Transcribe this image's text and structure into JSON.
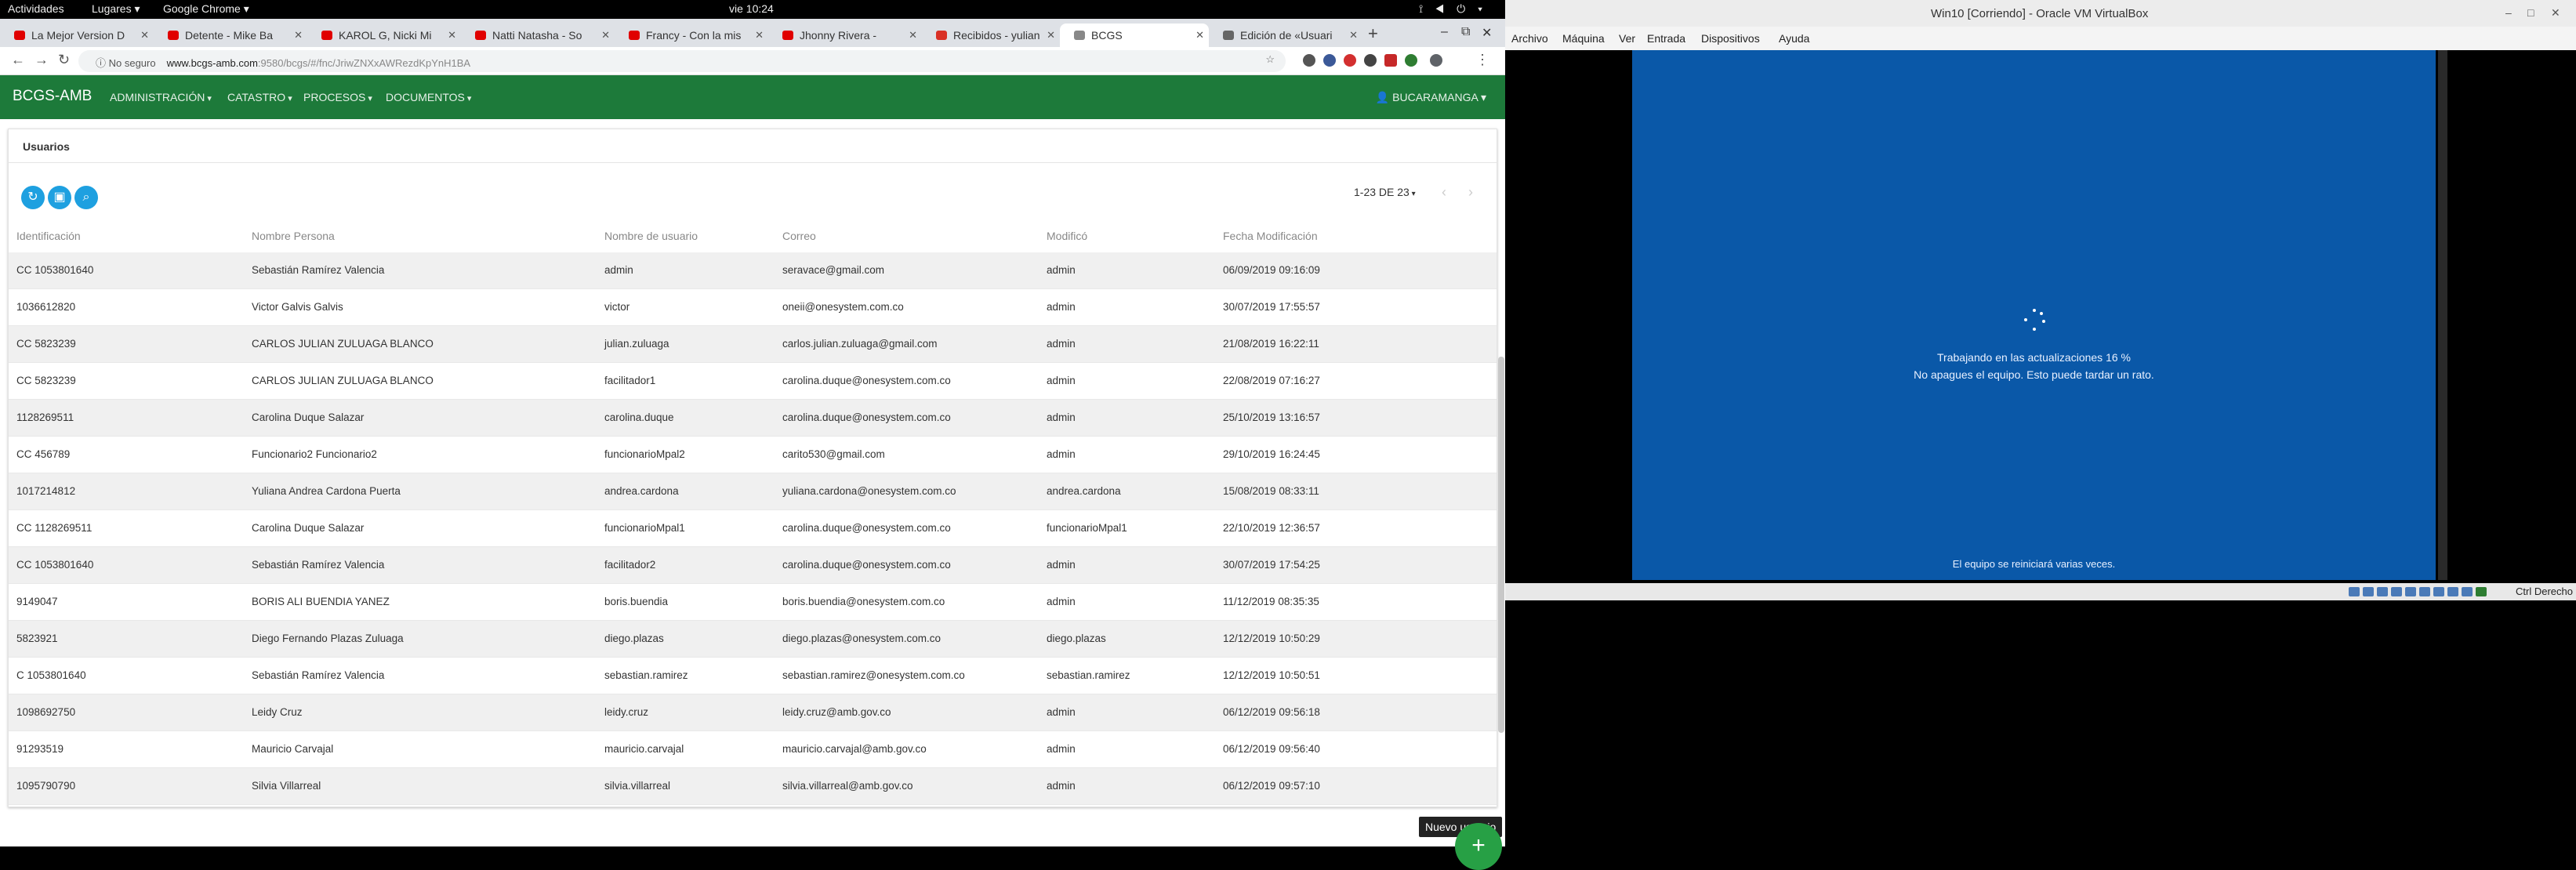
{
  "topbar": {
    "activities": "Actividades",
    "places": "Lugares ▾",
    "app": "Google Chrome ▾",
    "clock": "vie 10:24"
  },
  "chrome": {
    "tabs": [
      {
        "label": "La Mejor Version D",
        "color": "#e00000"
      },
      {
        "label": "Detente - Mike Ba",
        "color": "#e00000"
      },
      {
        "label": "KAROL G, Nicki Mi",
        "color": "#e00000"
      },
      {
        "label": "Natti Natasha - So",
        "color": "#e00000"
      },
      {
        "label": "Francy - Con la mis",
        "color": "#e00000"
      },
      {
        "label": "Jhonny Rivera - ",
        "color": "#e00000"
      },
      {
        "label": "Recibidos - yulian",
        "color": "#d93025"
      },
      {
        "label": "BCGS",
        "color": "#888888"
      },
      {
        "label": "Edición de «Usuari",
        "color": "#666666"
      }
    ],
    "omnibox": {
      "secure_label": "ⓘ No seguro",
      "url_host": "www.bcgs-amb.com",
      "url_path": ":9580/bcgs/#/fnc/JriwZNXxAWRezdKpYnH1BA"
    }
  },
  "app": {
    "brand": "BCGS-AMB",
    "menus": [
      "ADMINISTRACIÓN",
      "CATASTRO",
      "PROCESOS",
      "DOCUMENTOS"
    ],
    "user": "BUCARAMANGA",
    "panel_title": "Usuarios",
    "pager": "1-23 DE 23",
    "columns": [
      "Identificación",
      "Nombre Persona",
      "Nombre de usuario",
      "Correo",
      "Modificó",
      "Fecha Modificación"
    ],
    "rows": [
      [
        "CC 1053801640",
        "Sebastián Ramírez Valencia",
        "admin",
        "seravace@gmail.com",
        "admin",
        "06/09/2019 09:16:09"
      ],
      [
        "1036612820",
        "Victor Galvis Galvis",
        "victor",
        "oneii@onesystem.com.co",
        "admin",
        "30/07/2019 17:55:57"
      ],
      [
        "CC 5823239",
        "CARLOS JULIAN ZULUAGA BLANCO",
        "julian.zuluaga",
        "carlos.julian.zuluaga@gmail.com",
        "admin",
        "21/08/2019 16:22:11"
      ],
      [
        "CC 5823239",
        "CARLOS JULIAN ZULUAGA BLANCO",
        "facilitador1",
        "carolina.duque@onesystem.com.co",
        "admin",
        "22/08/2019 07:16:27"
      ],
      [
        "1128269511",
        "Carolina Duque Salazar",
        "carolina.duque",
        "carolina.duque@onesystem.com.co",
        "admin",
        "25/10/2019 13:16:57"
      ],
      [
        "CC 456789",
        "Funcionario2 Funcionario2",
        "funcionarioMpal2",
        "carito530@gmail.com",
        "admin",
        "29/10/2019 16:24:45"
      ],
      [
        "1017214812",
        "Yuliana Andrea Cardona Puerta",
        "andrea.cardona",
        "yuliana.cardona@onesystem.com.co",
        "andrea.cardona",
        "15/08/2019 08:33:11"
      ],
      [
        "CC 1128269511",
        "Carolina Duque Salazar",
        "funcionarioMpal1",
        "carolina.duque@onesystem.com.co",
        "funcionarioMpal1",
        "22/10/2019 12:36:57"
      ],
      [
        "CC 1053801640",
        "Sebastián Ramírez Valencia",
        "facilitador2",
        "carolina.duque@onesystem.com.co",
        "admin",
        "30/07/2019 17:54:25"
      ],
      [
        "9149047",
        "BORIS ALI BUENDIA YANEZ",
        "boris.buendia",
        "boris.buendia@onesystem.com.co",
        "admin",
        "11/12/2019 08:35:35"
      ],
      [
        "5823921",
        "Diego Fernando Plazas Zuluaga",
        "diego.plazas",
        "diego.plazas@onesystem.com.co",
        "diego.plazas",
        "12/12/2019 10:50:29"
      ],
      [
        "C 1053801640",
        "Sebastián Ramírez Valencia",
        "sebastian.ramirez",
        "sebastian.ramirez@onesystem.com.co",
        "sebastian.ramirez",
        "12/12/2019 10:50:51"
      ],
      [
        "1098692750",
        "Leidy Cruz",
        "leidy.cruz",
        "leidy.cruz@amb.gov.co",
        "admin",
        "06/12/2019 09:56:18"
      ],
      [
        "91293519",
        "Mauricio Carvajal",
        "mauricio.carvajal",
        "mauricio.carvajal@amb.gov.co",
        "admin",
        "06/12/2019 09:56:40"
      ],
      [
        "1095790790",
        "Silvia Villarreal",
        "silvia.villarreal",
        "silvia.villarreal@amb.gov.co",
        "admin",
        "06/12/2019 09:57:10"
      ]
    ],
    "tooltip": "Nuevo usuario",
    "fab_icon": "+"
  },
  "vbox": {
    "title": "Win10 [Corriendo] - Oracle VM VirtualBox",
    "menus": [
      "Archivo",
      "Máquina",
      "Ver",
      "Entrada",
      "Dispositivos",
      "Ayuda"
    ],
    "update_line1": "Trabajando en las actualizaciones  16 %",
    "update_line2": "No apagues el equipo. Esto puede tardar un rato.",
    "update_line3": "El equipo se reiniciará varias veces.",
    "host_key": "Ctrl Derecho",
    "screen_color": "#0a58a8"
  }
}
